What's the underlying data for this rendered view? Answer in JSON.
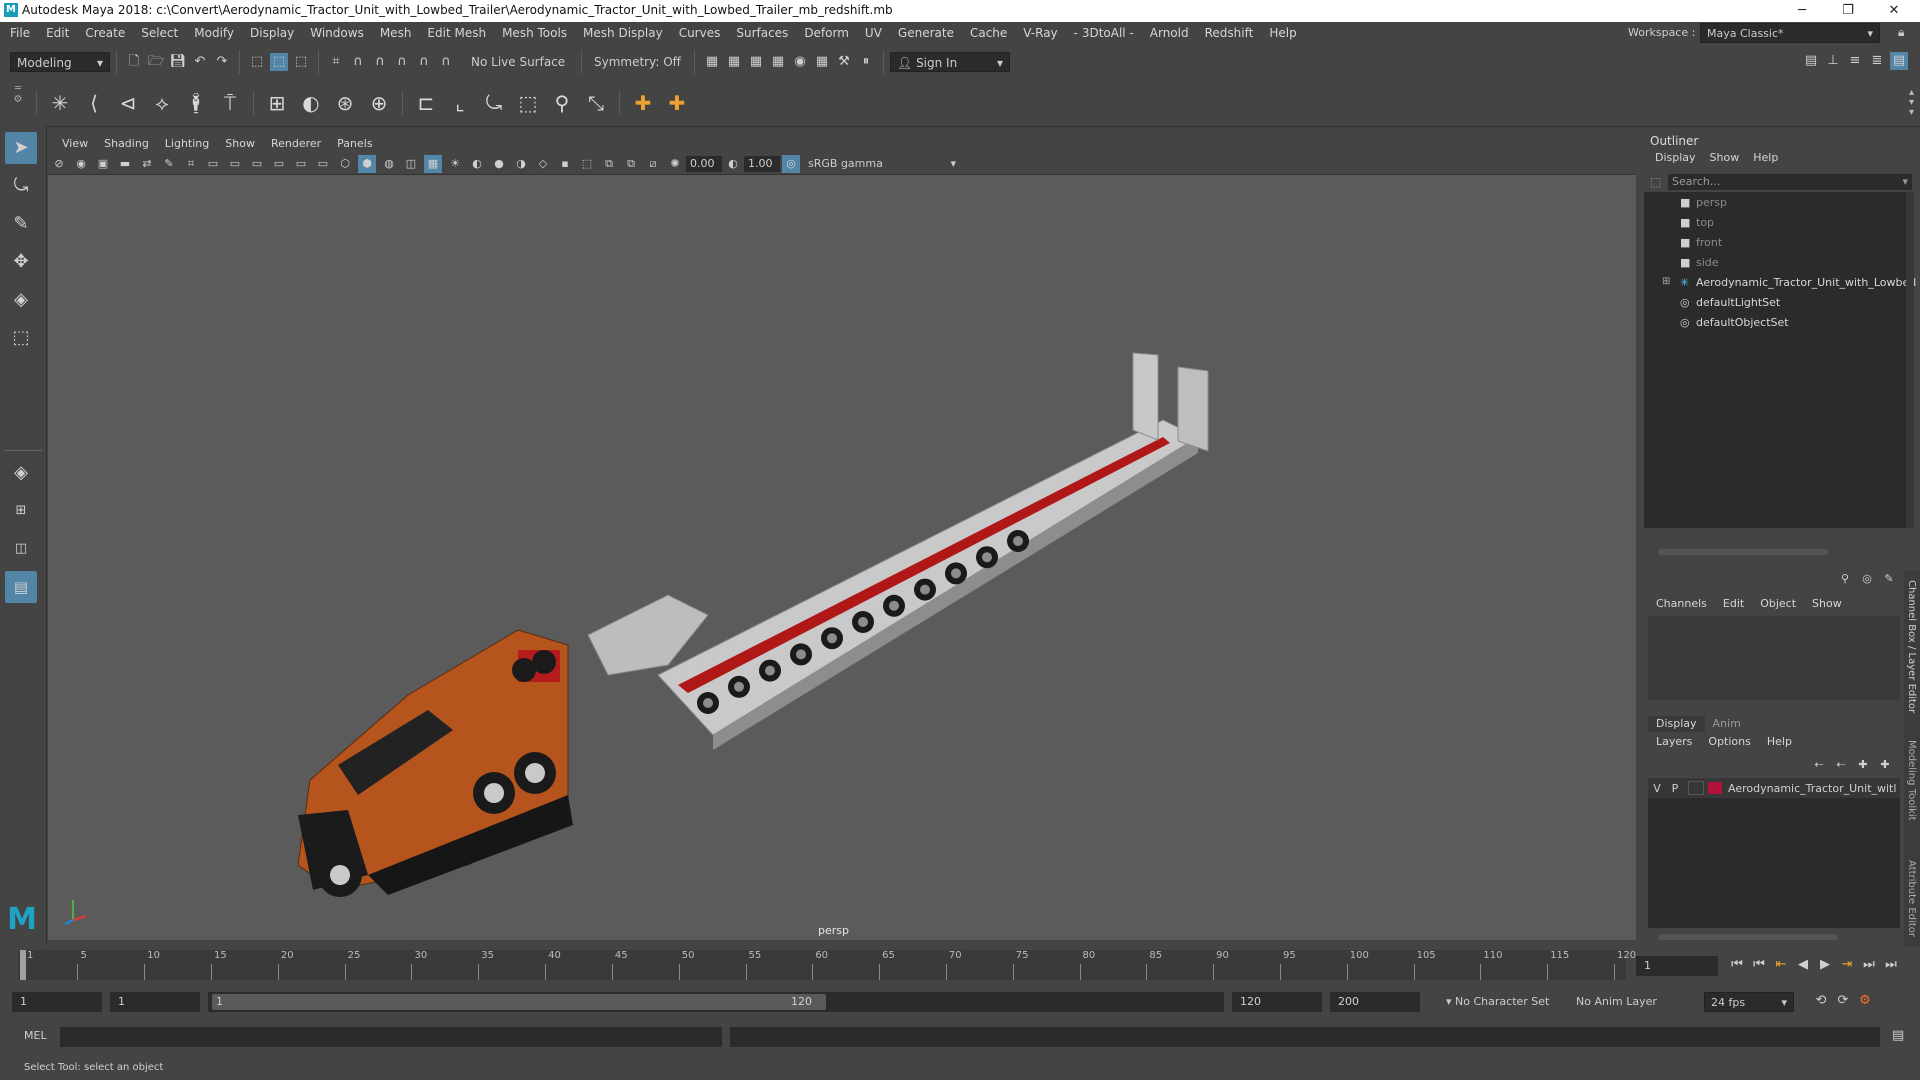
{
  "titlebar": {
    "title": "Autodesk Maya 2018: c:\\Convert\\Aerodynamic_Tractor_Unit_with_Lowbed_Trailer\\Aerodynamic_Tractor_Unit_with_Lowbed_Trailer_mb_redshift.mb",
    "minimize": "─",
    "maximize": "❐",
    "close": "✕"
  },
  "menubar": {
    "items": [
      "File",
      "Edit",
      "Create",
      "Select",
      "Modify",
      "Display",
      "Windows",
      "Mesh",
      "Edit Mesh",
      "Mesh Tools",
      "Mesh Display",
      "Curves",
      "Surfaces",
      "Deform",
      "UV",
      "Generate",
      "Cache",
      "V-Ray",
      "- 3DtoAll -",
      "Arnold",
      "Redshift",
      "Help"
    ],
    "workspace_label": "Workspace :",
    "workspace_value": "Maya Classic*"
  },
  "statusline": {
    "mode": "Modeling",
    "live_surface": "No Live Surface",
    "symmetry": "Symmetry: Off",
    "sign_in": "Sign In"
  },
  "viewport": {
    "menu": [
      "View",
      "Shading",
      "Lighting",
      "Show",
      "Renderer",
      "Panels"
    ],
    "exposure": "0.00",
    "gamma": "1.00",
    "color_space": "sRGB gamma",
    "camera_label": "persp"
  },
  "outliner": {
    "title": "Outliner",
    "menu": [
      "Display",
      "Show",
      "Help"
    ],
    "search_placeholder": "Search...",
    "items": [
      {
        "label": "persp",
        "dim": true
      },
      {
        "label": "top",
        "dim": true
      },
      {
        "label": "front",
        "dim": true
      },
      {
        "label": "side",
        "dim": true
      },
      {
        "label": "Aerodynamic_Tractor_Unit_with_Lowbed",
        "dim": false
      },
      {
        "label": "defaultLightSet",
        "dim": false
      },
      {
        "label": "defaultObjectSet",
        "dim": false
      }
    ]
  },
  "channelbox": {
    "menu": [
      "Channels",
      "Edit",
      "Object",
      "Show"
    ],
    "tabs": [
      "Display",
      "Anim"
    ],
    "layer_menu": [
      "Layers",
      "Options",
      "Help"
    ],
    "layer": {
      "v": "V",
      "p": "P",
      "name": "Aerodynamic_Tractor_Unit_witl",
      "color": "#b0123a"
    }
  },
  "right_tabs": [
    "Channel Box / Layer Editor",
    "Modeling Toolkit",
    "Attribute Editor"
  ],
  "timeslider": {
    "ticks": [
      "1",
      "5",
      "10",
      "15",
      "20",
      "25",
      "30",
      "35",
      "40",
      "45",
      "50",
      "55",
      "60",
      "65",
      "70",
      "75",
      "80",
      "85",
      "90",
      "95",
      "100",
      "105",
      "110",
      "115",
      "120"
    ],
    "current_frame": "1"
  },
  "rangeslider": {
    "start": "1",
    "playback_start": "1",
    "range_start": "1",
    "range_end": "120",
    "playback_end": "120",
    "end": "200",
    "character_set": "No Character Set",
    "anim_layer": "No Anim Layer",
    "fps": "24 fps"
  },
  "cmdline": {
    "label": "MEL"
  },
  "helpline": {
    "text": "Select Tool: select an object"
  },
  "colors": {
    "accent": "#5285a6",
    "trailer_stripe": "#b01818",
    "cab": "#b5541c"
  }
}
